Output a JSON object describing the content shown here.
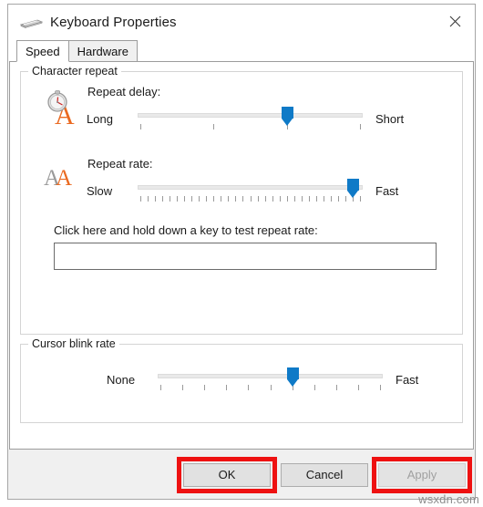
{
  "window": {
    "title": "Keyboard Properties",
    "icon": "keyboard-icon",
    "close_label": "✕"
  },
  "tabs": [
    {
      "label": "Speed",
      "active": true
    },
    {
      "label": "Hardware",
      "active": false
    }
  ],
  "character_repeat": {
    "group_title": "Character repeat",
    "repeat_delay": {
      "icon": "stopwatch-letter-a-icon",
      "label": "Repeat delay:",
      "left_label": "Long",
      "right_label": "Short",
      "ticks": 4,
      "value": 2,
      "max": 3
    },
    "repeat_rate": {
      "icon": "double-letter-a-icon",
      "label": "Repeat rate:",
      "left_label": "Slow",
      "right_label": "Fast",
      "ticks": 31,
      "value": 30,
      "max": 31
    },
    "test_field": {
      "label": "Click here and hold down a key to test repeat rate:",
      "value": "",
      "placeholder": ""
    }
  },
  "cursor_blink": {
    "group_title": "Cursor blink rate",
    "slider": {
      "left_label": "None",
      "right_label": "Fast",
      "ticks": 11,
      "value": 6,
      "max": 10
    }
  },
  "footer": {
    "ok_label": "OK",
    "cancel_label": "Cancel",
    "apply_label": "Apply",
    "apply_disabled": true
  },
  "watermark": "wsxdn.com",
  "colors": {
    "accent": "#0f7ac7",
    "annotation": "#ee1111",
    "icon_orange": "#ea6a21",
    "icon_gray": "#9a9a9a"
  }
}
